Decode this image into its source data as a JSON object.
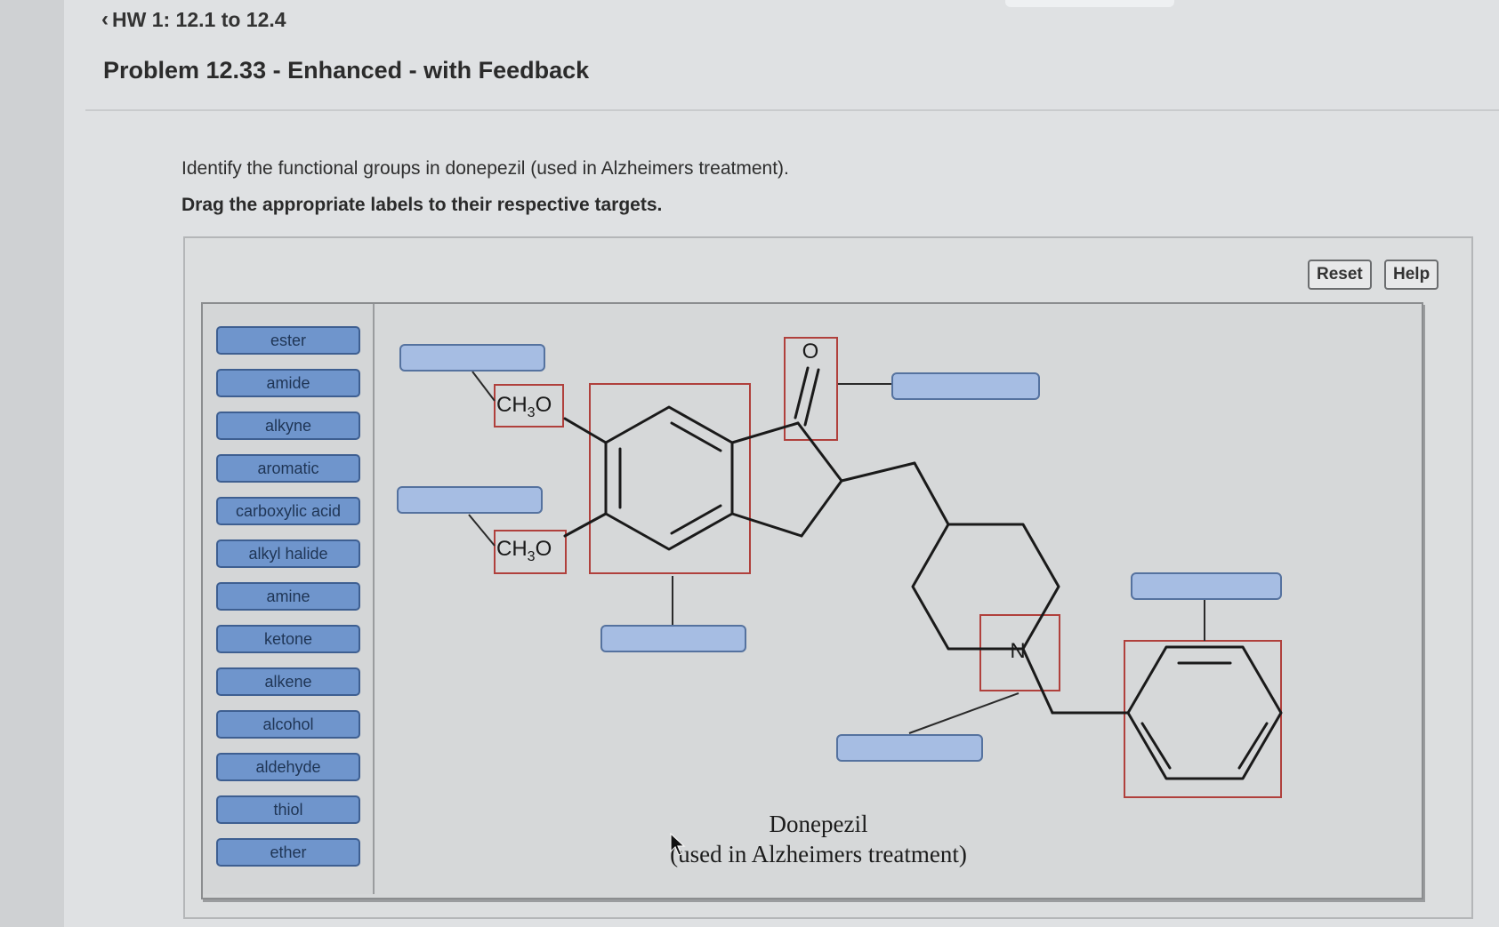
{
  "header": {
    "breadcrumb": "HW 1: 12.1 to 12.4",
    "problem_title": "Problem 12.33 - Enhanced - with Feedback"
  },
  "question": {
    "text": "Identify the functional groups in donepezil (used in Alzheimers treatment).",
    "instruction": "Drag the appropriate labels to their respective targets."
  },
  "toolbar": {
    "reset_label": "Reset",
    "help_label": "Help"
  },
  "labels": [
    "ester",
    "amide",
    "alkyne",
    "aromatic",
    "carboxylic acid",
    "alkyl halide",
    "amine",
    "ketone",
    "alkene",
    "alcohol",
    "aldehyde",
    "thiol",
    "ether"
  ],
  "molecule": {
    "ch3o_top": "CH3O",
    "ch3o_bottom": "CH3O",
    "oxygen": "O",
    "nitrogen": "N",
    "name": "Donepezil",
    "subtitle": "(used in Alzheimers treatment)"
  },
  "colors": {
    "chip_fill": "#6f95cc",
    "target_fill": "#a6bde3",
    "highlight_box": "#b0403c"
  }
}
